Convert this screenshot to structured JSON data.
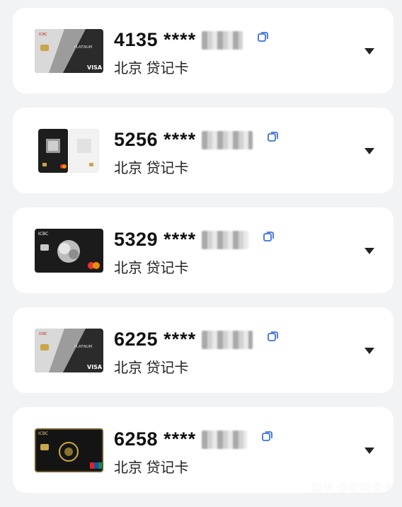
{
  "cards": [
    {
      "number_prefix": "4135",
      "masked": "****",
      "description": "北京 贷记卡",
      "design": "platinum-visa",
      "brand": "VISA",
      "tier": "PLATINUM"
    },
    {
      "number_prefix": "5256",
      "masked": "****",
      "description": "北京 贷记卡",
      "design": "qr-split",
      "brand": "mastercard"
    },
    {
      "number_prefix": "5329",
      "masked": "****",
      "description": "北京 贷记卡",
      "design": "black-peony",
      "brand": "mastercard"
    },
    {
      "number_prefix": "6225",
      "masked": "****",
      "description": "北京 贷记卡",
      "design": "platinum-visa",
      "brand": "VISA",
      "tier": "PLATINUM"
    },
    {
      "number_prefix": "6258",
      "masked": "****",
      "description": "北京 贷记卡",
      "design": "black-gold-unionpay",
      "brand": "UnionPay"
    }
  ],
  "watermark": "知乎 @老胡说卡",
  "colors": {
    "background": "#f2f3f5",
    "card_bg": "#ffffff",
    "copy_icon": "#3d6fe0",
    "text": "#111111"
  },
  "icons": {
    "copy": "copy-icon",
    "expand": "chevron-down-icon"
  }
}
